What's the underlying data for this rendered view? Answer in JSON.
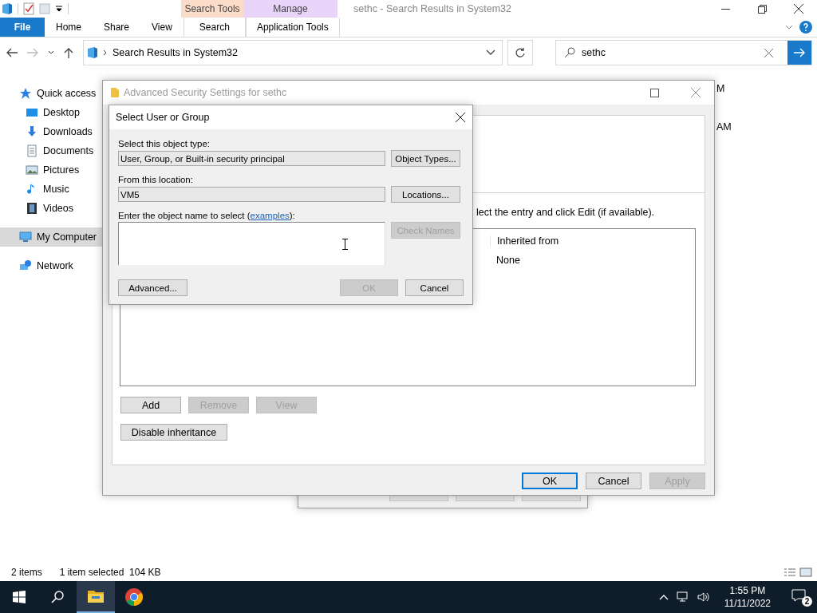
{
  "explorer": {
    "title": "sethc - Search Results in System32",
    "context_groups": [
      {
        "label": "Search Tools",
        "color": "#fbdcc8"
      },
      {
        "label": "Manage",
        "color": "#e8d4f8"
      }
    ],
    "ribbon_tabs": [
      {
        "label": "File",
        "kind": "file",
        "selected": false
      },
      {
        "label": "Home",
        "kind": "normal",
        "selected": false
      },
      {
        "label": "Share",
        "kind": "normal",
        "selected": false
      },
      {
        "label": "View",
        "kind": "normal",
        "selected": false
      },
      {
        "label": "Search",
        "kind": "context",
        "selected": false
      },
      {
        "label": "Application Tools",
        "kind": "context",
        "selected": false
      }
    ],
    "address": "Search Results in System32",
    "search": "sethc",
    "sidebar": [
      {
        "label": "Quick access",
        "children": [
          {
            "label": "Desktop",
            "selected": false
          },
          {
            "label": "Downloads",
            "selected": false
          },
          {
            "label": "Documents",
            "selected": false
          },
          {
            "label": "Pictures",
            "selected": false
          },
          {
            "label": "Music",
            "selected": false
          },
          {
            "label": "Videos",
            "selected": false
          }
        ],
        "selected": false
      },
      {
        "label": "My Computer",
        "selected": true
      },
      {
        "label": "Network",
        "selected": false
      }
    ],
    "content_fragments": [
      "M",
      "AM"
    ],
    "status_bar": {
      "items": "2 items",
      "selection": "1 item selected  104 KB"
    }
  },
  "advanced_security": {
    "title": "Advanced Security Settings for sethc",
    "instruction": "lect the entry and click Edit (if available).",
    "table": {
      "column": "Inherited from",
      "rows": [
        "None"
      ]
    },
    "entry_buttons": [
      {
        "label": "Add",
        "disabled": false
      },
      {
        "label": "Remove",
        "disabled": true
      },
      {
        "label": "View",
        "disabled": true
      }
    ],
    "inheritance_button": "Disable inheritance",
    "footer_buttons": [
      {
        "label": "OK",
        "disabled": false,
        "default": true
      },
      {
        "label": "Cancel",
        "disabled": false,
        "default": false
      },
      {
        "label": "Apply",
        "disabled": true,
        "default": false
      }
    ]
  },
  "select_dialog": {
    "title": "Select User or Group",
    "object_type_label": "Select this object type:",
    "object_type": "User, Group, or Built-in security principal",
    "object_types_button": "Object Types...",
    "location_label": "From this location:",
    "location": "VM5",
    "locations_button": "Locations...",
    "name_label": "Enter the object name to select (",
    "name_link": "examples",
    "name_label_end": "):",
    "check_names": {
      "label": "Check Names",
      "disabled": true
    },
    "advanced_button": "Advanced...",
    "ok": {
      "label": "OK",
      "disabled": true
    },
    "cancel": {
      "label": "Cancel",
      "disabled": false
    }
  },
  "taskbar": {
    "time": "1:55 PM",
    "date": "11/11/2022",
    "notifications": "2"
  }
}
